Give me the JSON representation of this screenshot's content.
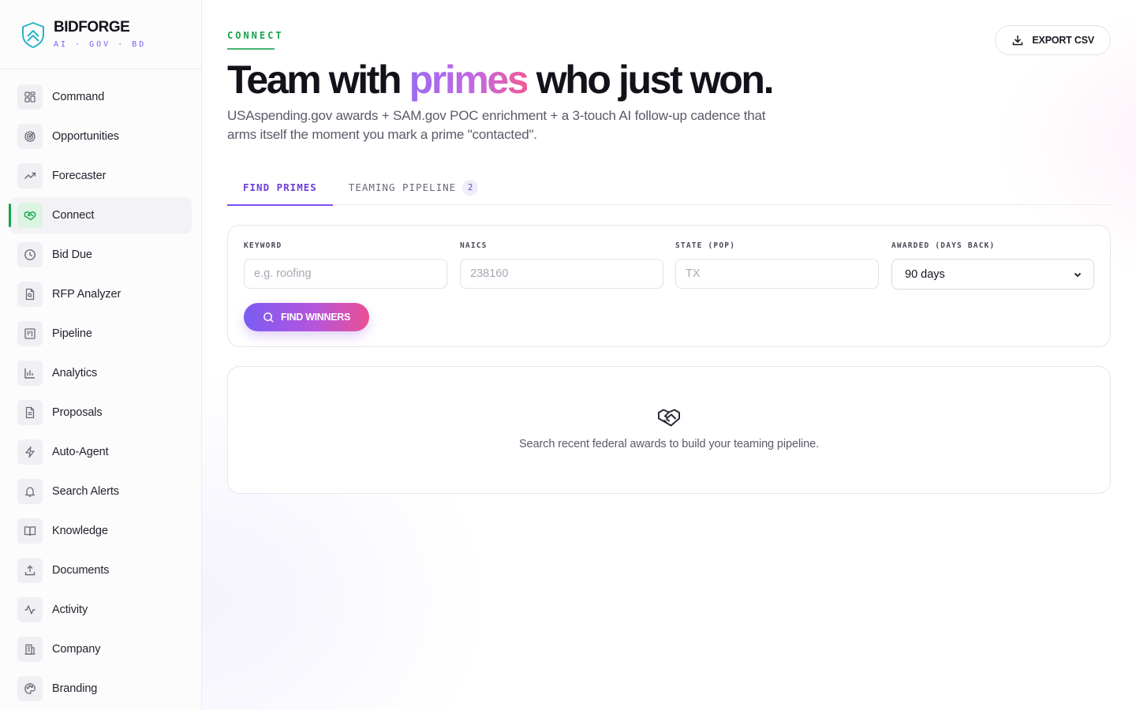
{
  "brand": {
    "name": "BIDFORGE",
    "tagline": "AI · GOV · BD"
  },
  "sidebar": {
    "items": [
      {
        "label": "Command",
        "icon": "grid-icon"
      },
      {
        "label": "Opportunities",
        "icon": "target-icon"
      },
      {
        "label": "Forecaster",
        "icon": "trending-up-icon"
      },
      {
        "label": "Connect",
        "icon": "handshake-icon",
        "active": true
      },
      {
        "label": "Bid Due",
        "icon": "clock-icon"
      },
      {
        "label": "RFP Analyzer",
        "icon": "file-search-icon"
      },
      {
        "label": "Pipeline",
        "icon": "kanban-icon"
      },
      {
        "label": "Analytics",
        "icon": "bar-chart-icon"
      },
      {
        "label": "Proposals",
        "icon": "document-icon"
      },
      {
        "label": "Auto-Agent",
        "icon": "lightning-icon"
      },
      {
        "label": "Search Alerts",
        "icon": "bell-icon"
      },
      {
        "label": "Knowledge",
        "icon": "book-icon"
      },
      {
        "label": "Documents",
        "icon": "upload-icon"
      },
      {
        "label": "Activity",
        "icon": "activity-icon"
      },
      {
        "label": "Company",
        "icon": "building-icon"
      },
      {
        "label": "Branding",
        "icon": "palette-icon"
      }
    ]
  },
  "header": {
    "eyebrow": "CONNECT",
    "title_prefix": "Team with ",
    "title_accent": "primes",
    "title_suffix": " who just won.",
    "subtitle": "USAspending.gov awards + SAM.gov POC enrichment + a 3-touch AI follow-up cadence that arms itself the moment you mark a prime \"contacted\".",
    "export_label": "EXPORT CSV"
  },
  "tabs": [
    {
      "label": "FIND PRIMES",
      "active": true
    },
    {
      "label": "TEAMING PIPELINE",
      "badge": "2"
    }
  ],
  "filters": {
    "keyword": {
      "label": "KEYWORD",
      "placeholder": "e.g. roofing",
      "value": ""
    },
    "naics": {
      "label": "NAICS",
      "placeholder": "238160",
      "value": ""
    },
    "state": {
      "label": "STATE (POP)",
      "placeholder": "TX",
      "value": ""
    },
    "awarded": {
      "label": "AWARDED (DAYS BACK)",
      "selected": "90 days"
    },
    "submit_label": "FIND WINNERS"
  },
  "empty_state": {
    "icon": "handshake-icon",
    "message": "Search recent federal awards to build your teaming pipeline."
  },
  "colors": {
    "accent_green": "#16a34a",
    "accent_purple": "#7c4ff0",
    "gradient_start": "#7b5cf2",
    "gradient_end": "#ea4f93"
  }
}
